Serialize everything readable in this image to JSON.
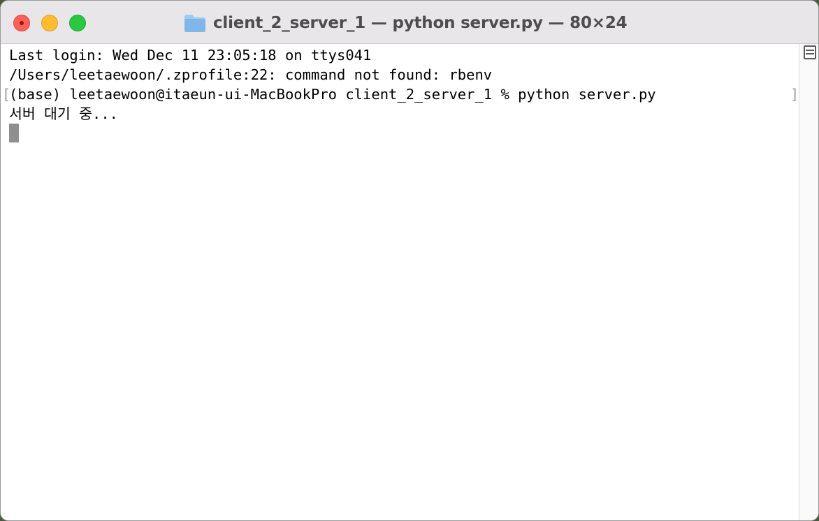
{
  "window": {
    "title": "client_2_server_1 — python server.py — 80×24",
    "folder_icon": "folder-icon",
    "controls": {
      "close": "close-icon",
      "minimize": "minimize-icon",
      "zoom": "zoom-icon"
    }
  },
  "terminal": {
    "lines": [
      "Last login: Wed Dec 11 23:05:18 on ttys041",
      "/Users/leetaewoon/.zprofile:22: command not found: rbenv",
      "(base) leetaewoon@itaeun-ui-MacBookPro client_2_server_1 % python server.py",
      "서버 대기 중..."
    ],
    "prompt_marks": {
      "left": "[",
      "right": "]"
    }
  },
  "scrollbar": {
    "split_icon": "split-pane-icon"
  },
  "colors": {
    "titlebar_bg": "#e8e6e8",
    "terminal_bg": "#ffffff",
    "text": "#000000",
    "title_text": "#4d4d4d",
    "close": "#fe5f57",
    "minimize": "#febc2e",
    "zoom": "#28c840",
    "folder": "#7fb7e8",
    "cursor": "#8f8f8f"
  }
}
